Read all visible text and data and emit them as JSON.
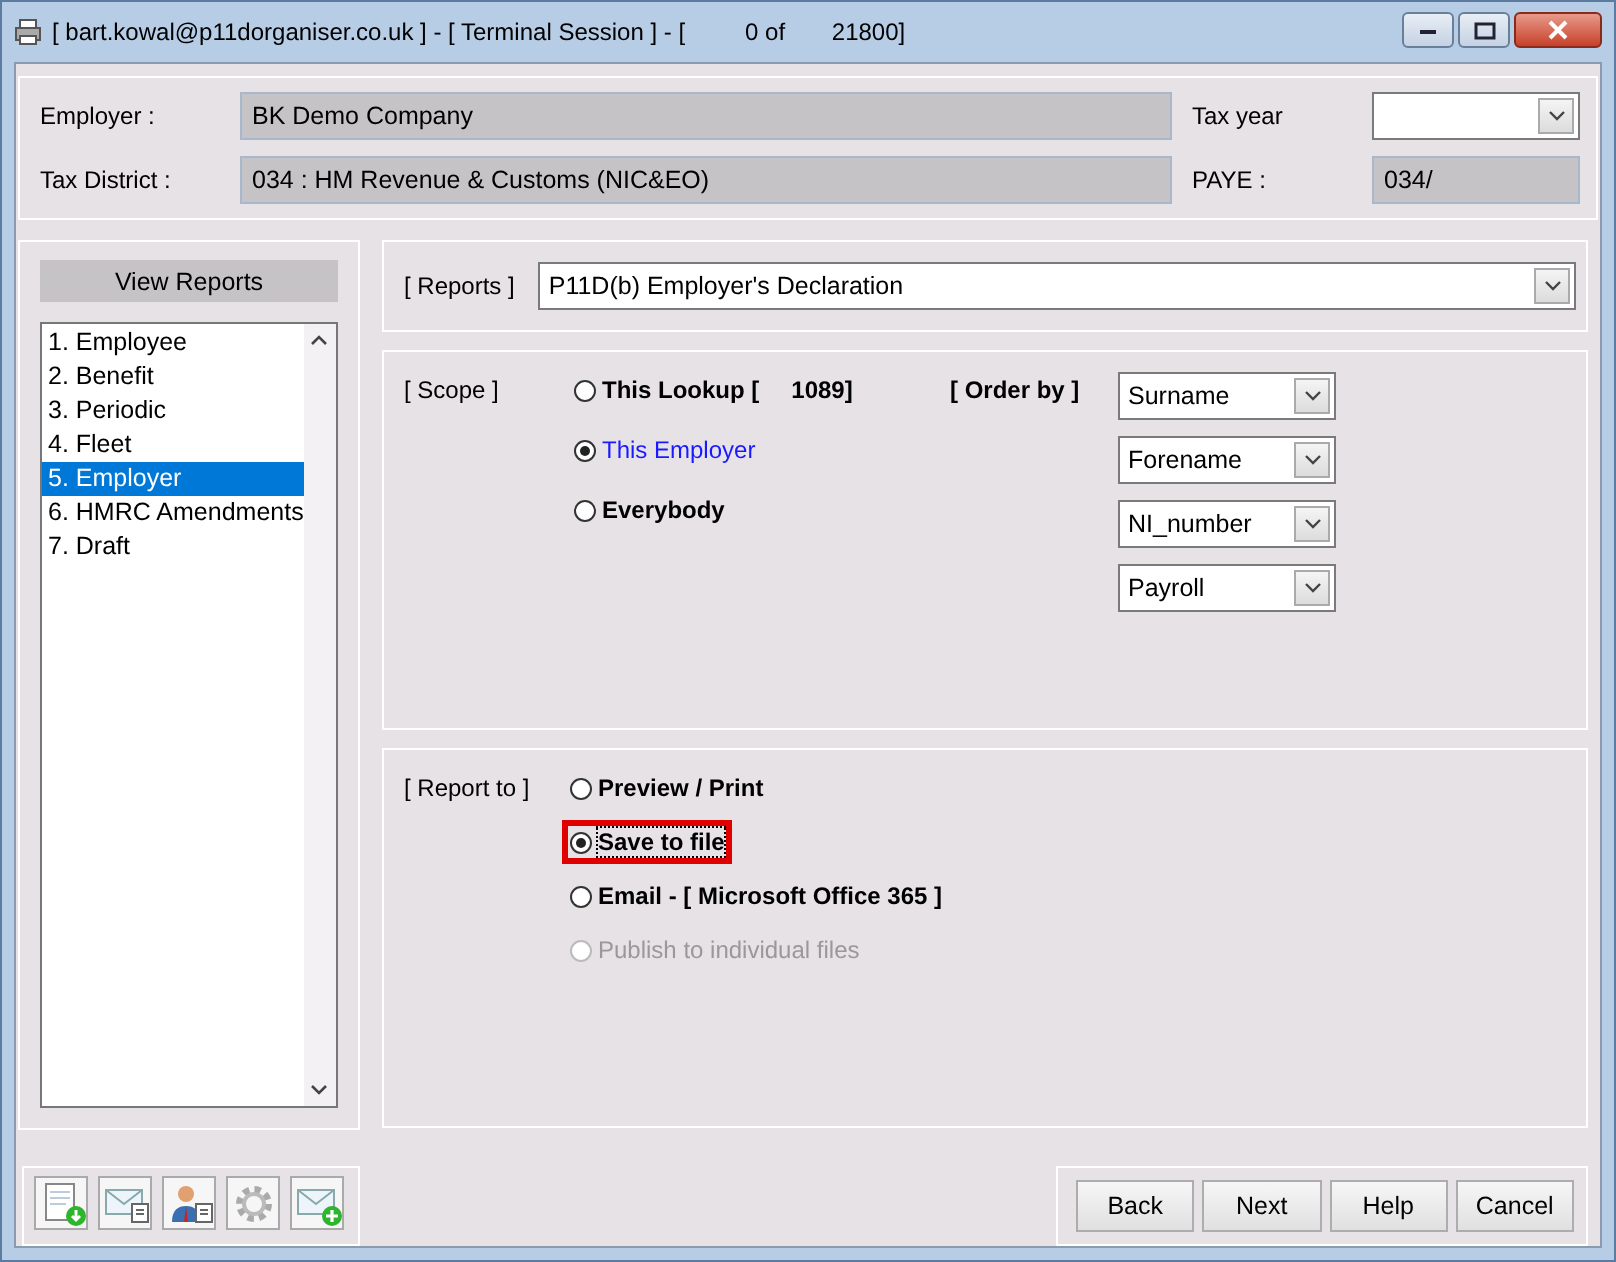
{
  "window": {
    "title": "[ bart.kowal@p11dorganiser.co.uk ] - [ Terminal Session ] - [         0 of       21800]"
  },
  "header": {
    "employer_label": "Employer :",
    "employer": "BK Demo Company",
    "tax_year_label": "Tax year",
    "tax_district_label": "Tax District :",
    "tax_district": "034 : HM Revenue & Customs (NIC&EO)",
    "paye_label": "PAYE :",
    "paye": "034/"
  },
  "sidebar": {
    "title": "View Reports",
    "items": [
      {
        "label": "1. Employee",
        "selected": false
      },
      {
        "label": "2. Benefit",
        "selected": false
      },
      {
        "label": "3. Periodic",
        "selected": false
      },
      {
        "label": "4. Fleet",
        "selected": false
      },
      {
        "label": "5. Employer",
        "selected": true
      },
      {
        "label": "6. HMRC Amendments",
        "selected": false
      },
      {
        "label": "7. Draft",
        "selected": false
      }
    ]
  },
  "reports": {
    "label": "[ Reports ]",
    "value": "P11D(b) Employer's Declaration"
  },
  "scope": {
    "label": "[ Scope ]",
    "options": [
      {
        "label": "This Lookup [",
        "count": "1089]",
        "selected": false
      },
      {
        "label": "This Employer",
        "selected": true
      },
      {
        "label": "Everybody",
        "selected": false
      }
    ],
    "order_by_label": "[ Order by ]",
    "order_by": [
      "Surname",
      "Forename",
      "NI_number",
      "Payroll"
    ]
  },
  "report_to": {
    "label": "[ Report to ]",
    "options": [
      {
        "label": "Preview / Print",
        "selected": false,
        "disabled": false,
        "highlighted": false
      },
      {
        "label": "Save to file",
        "selected": true,
        "disabled": false,
        "highlighted": true
      },
      {
        "label": "Email - [ Microsoft Office 365 ]",
        "selected": false,
        "disabled": false,
        "highlighted": false
      },
      {
        "label": "Publish to individual files",
        "selected": false,
        "disabled": true,
        "highlighted": false
      }
    ]
  },
  "buttons": [
    "Back",
    "Next",
    "Help",
    "Cancel"
  ]
}
